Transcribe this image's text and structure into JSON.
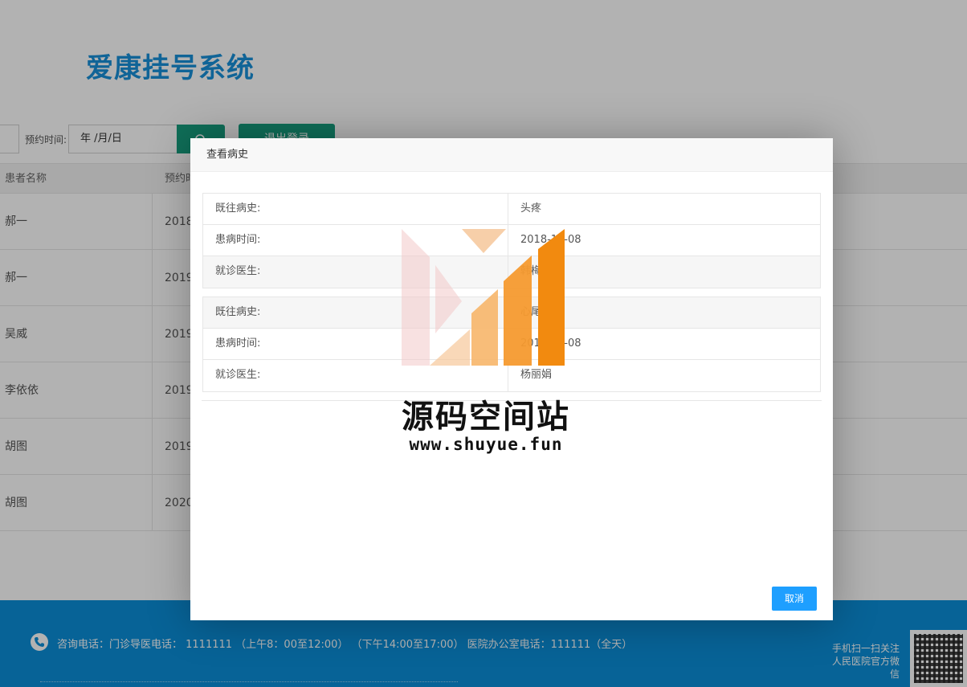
{
  "site": {
    "title": "爱康挂号系统"
  },
  "search": {
    "time_label": "预约时间:",
    "date_value": "年 /月/日",
    "logout_label": "退出登录"
  },
  "table": {
    "headers": [
      "患者名称",
      "预约时间"
    ],
    "rows": [
      {
        "patient": "郝一",
        "time": "2018"
      },
      {
        "patient": "郝一",
        "time": "2019"
      },
      {
        "patient": "吴威",
        "time": "2019"
      },
      {
        "patient": "李依依",
        "time": "2019"
      },
      {
        "patient": "胡图",
        "time": "2019"
      },
      {
        "patient": "胡图",
        "time": "2020"
      }
    ]
  },
  "footer": {
    "contact": "咨询电话：门诊导医电话： 1111111 （上午8：00至12:00） （下午14:00至17:00）     医院办公室电话：111111（全天）",
    "wechat_prompt": "手机扫一扫关注人民医院官方微信"
  },
  "modal": {
    "title": "查看病史",
    "cancel_label": "取消",
    "records": [
      {
        "history_label": "既往病史:",
        "history": "头疼",
        "date_label": "患病时间:",
        "date": "2018-10-08",
        "doctor_label": "就诊医生:",
        "doctor": "韩梅梅"
      },
      {
        "history_label": "既往病史:",
        "history": "心尾",
        "date_label": "患病时间:",
        "date": "2019-10-08",
        "doctor_label": "就诊医生:",
        "doctor": "杨丽娟"
      }
    ]
  },
  "watermark": {
    "name": "源码空间站",
    "url": "www.shuyue.fun"
  },
  "colors": {
    "brand": "#1890d8",
    "primary_button": "#1e9fff",
    "footer": "#0b8fd9",
    "green_button": "#169e7e"
  },
  "icons": {
    "search": "search-icon",
    "phone": "phone-icon",
    "qr": "qr-code-icon"
  }
}
